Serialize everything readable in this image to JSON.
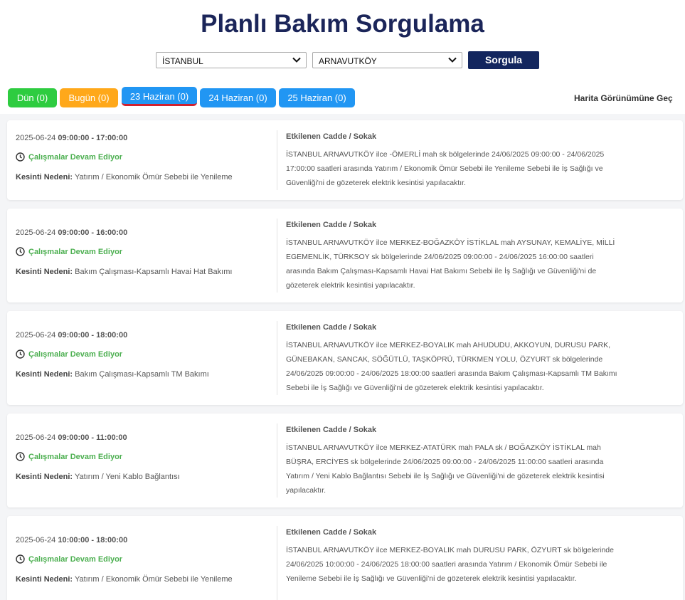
{
  "title": "Planlı Bakım Sorgulama",
  "filters": {
    "city": "İSTANBUL",
    "district": "ARNAVUTKÖY",
    "search_button": "Sorgula"
  },
  "tabs": [
    {
      "label": "Dün (0)",
      "color": "#2ecc40"
    },
    {
      "label": "Bugün (0)",
      "color": "#ffa81a"
    },
    {
      "label": "23 Haziran (0)",
      "color": "#2196f3",
      "active": true
    },
    {
      "label": "24 Haziran (0)",
      "color": "#2196f3"
    },
    {
      "label": "25 Haziran (0)",
      "color": "#2196f3"
    }
  ],
  "map_link": "Harita Görünümüne Geç",
  "labels": {
    "affected": "Etkilenen Cadde / Sokak",
    "reason": "Kesinti Nedeni:",
    "status": "Çalışmalar Devam Ediyor"
  },
  "outages": [
    {
      "date": "2025-06-24",
      "time": "09:00:00 - 17:00:00",
      "reason": "Yatırım / Ekonomik Ömür Sebebi ile Yenileme",
      "description": "İSTANBUL ARNAVUTKÖY ilce -ÖMERLİ mah sk bölgelerinde 24/06/2025 09:00:00 - 24/06/2025 17:00:00 saatleri arasında Yatırım / Ekonomik Ömür Sebebi ile Yenileme Sebebi ile İş Sağlığı ve Güvenliği'ni de gözeterek elektrik kesintisi yapılacaktır."
    },
    {
      "date": "2025-06-24",
      "time": "09:00:00 - 16:00:00",
      "reason": "Bakım Çalışması-Kapsamlı Havai Hat Bakımı",
      "description": "İSTANBUL ARNAVUTKÖY ilce MERKEZ-BOĞAZKÖY İSTİKLAL mah AYSUNAY, KEMALİYE, MİLLİ EGEMENLİK, TÜRKSOY sk bölgelerinde 24/06/2025 09:00:00 - 24/06/2025 16:00:00 saatleri arasında Bakım Çalışması-Kapsamlı Havai Hat Bakımı Sebebi ile İş Sağlığı ve Güvenliği'ni de gözeterek elektrik kesintisi yapılacaktır."
    },
    {
      "date": "2025-06-24",
      "time": "09:00:00 - 18:00:00",
      "reason": "Bakım Çalışması-Kapsamlı TM Bakımı",
      "description": "İSTANBUL ARNAVUTKÖY ilce MERKEZ-BOYALIK mah AHUDUDU, AKKOYUN, DURUSU PARK, GÜNEBAKAN, SANCAK, SÖĞÜTLÜ, TAŞKÖPRÜ, TÜRKMEN YOLU, ÖZYURT sk bölgelerinde 24/06/2025 09:00:00 - 24/06/2025 18:00:00 saatleri arasında Bakım Çalışması-Kapsamlı TM Bakımı Sebebi ile İş Sağlığı ve Güvenliği'ni de gözeterek elektrik kesintisi yapılacaktır."
    },
    {
      "date": "2025-06-24",
      "time": "09:00:00 - 11:00:00",
      "reason": "Yatırım / Yeni Kablo Bağlantısı",
      "description": "İSTANBUL ARNAVUTKÖY ilce MERKEZ-ATATÜRK mah PALA sk / BOĞAZKÖY İSTİKLAL mah BÜŞRA, ERCİYES sk bölgelerinde 24/06/2025 09:00:00 - 24/06/2025 11:00:00 saatleri arasında Yatırım / Yeni Kablo Bağlantısı Sebebi ile İş Sağlığı ve Güvenliği'ni de gözeterek elektrik kesintisi yapılacaktır."
    },
    {
      "date": "2025-06-24",
      "time": "10:00:00 - 18:00:00",
      "reason": "Yatırım / Ekonomik Ömür Sebebi ile Yenileme",
      "description": "İSTANBUL ARNAVUTKÖY ilce MERKEZ-BOYALIK mah DURUSU PARK, ÖZYURT sk bölgelerinde 24/06/2025 10:00:00 - 24/06/2025 18:00:00 saatleri arasında Yatırım / Ekonomik Ömür Sebebi ile Yenileme Sebebi ile İş Sağlığı ve Güvenliği'ni de gözeterek elektrik kesintisi yapılacaktır."
    }
  ]
}
